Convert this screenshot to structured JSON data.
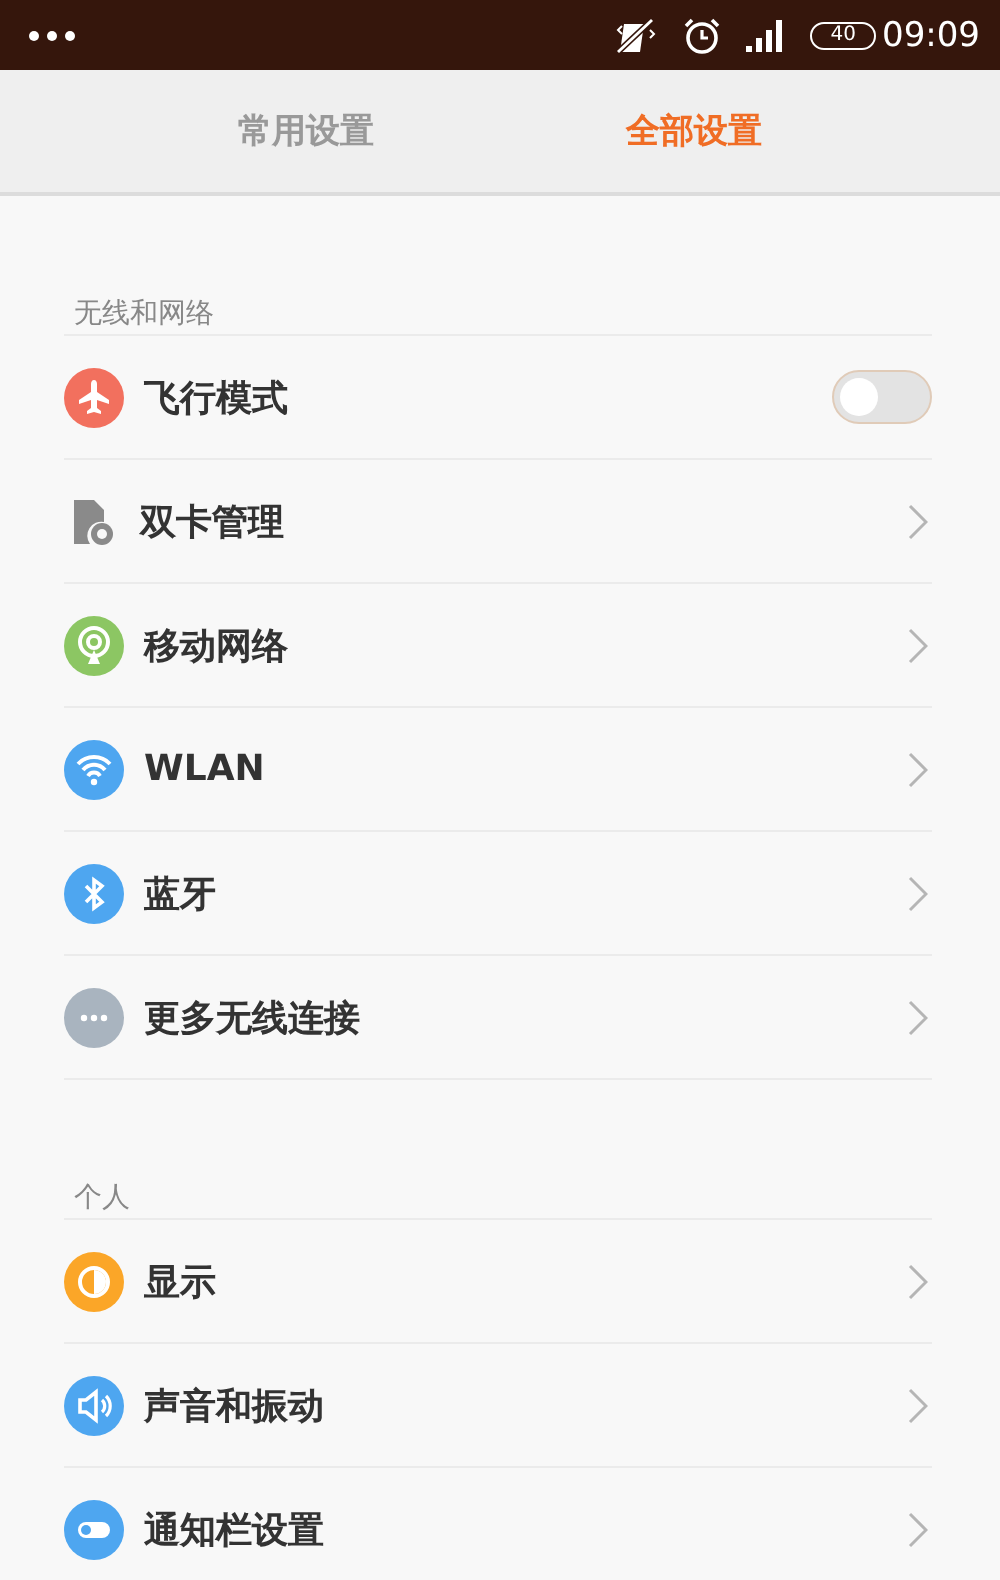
{
  "status_bar": {
    "battery": "40",
    "time": "09:09"
  },
  "tabs": [
    {
      "label": "常用设置",
      "selected": false
    },
    {
      "label": "全部设置",
      "selected": true
    }
  ],
  "sections": [
    {
      "title": "无线和网络",
      "items": [
        {
          "label": "飞行模式",
          "kind": "toggle",
          "on": false,
          "color": "#f2705e"
        },
        {
          "label": "双卡管理",
          "kind": "link",
          "color": "#8a8a8a"
        },
        {
          "label": "移动网络",
          "kind": "link",
          "color": "#8cc663"
        },
        {
          "label": "WLAN",
          "kind": "link",
          "color": "#4ea6f0"
        },
        {
          "label": "蓝牙",
          "kind": "link",
          "color": "#4ea6f0"
        },
        {
          "label": "更多无线连接",
          "kind": "link",
          "color": "#a9b4bf"
        }
      ]
    },
    {
      "title": "个人",
      "items": [
        {
          "label": "显示",
          "kind": "link",
          "color": "#fba628"
        },
        {
          "label": "声音和振动",
          "kind": "link",
          "color": "#4ea6f0"
        },
        {
          "label": "通知栏设置",
          "kind": "link",
          "color": "#4ea6f0"
        }
      ]
    }
  ]
}
